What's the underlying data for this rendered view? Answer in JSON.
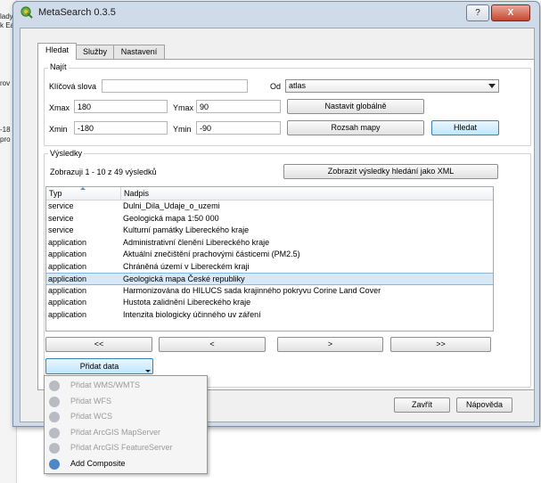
{
  "background": {
    "fragments": [
      "lady",
      "k Ea",
      "rov",
      "-18",
      "pro"
    ]
  },
  "window": {
    "title": "MetaSearch 0.3.5",
    "help_btn": "?",
    "close_btn": "X"
  },
  "tabs": [
    "Hledat",
    "Služby",
    "Nastavení"
  ],
  "find": {
    "group_title": "Najít",
    "keywords_label": "Klíčová slova",
    "keywords_value": "",
    "from_label": "Od",
    "from_value": "atlas",
    "xmax_label": "Xmax",
    "xmax_value": "180",
    "ymax_label": "Ymax",
    "ymax_value": "90",
    "xmin_label": "Xmin",
    "xmin_value": "-180",
    "ymin_label": "Ymin",
    "ymin_value": "-90",
    "set_global_btn": "Nastavit globálně",
    "map_extent_btn": "Rozsah mapy",
    "search_btn": "Hledat"
  },
  "results": {
    "group_title": "Výsledky",
    "summary": "Zobrazuji 1 - 10 z 49 výsledků",
    "xml_btn": "Zobrazit výsledky hledání jako XML",
    "columns": [
      "Typ",
      "Nadpis"
    ],
    "rows": [
      [
        "service",
        "Dulni_Dila_Udaje_o_uzemi"
      ],
      [
        "service",
        "Geologická mapa 1:50 000"
      ],
      [
        "service",
        "Kulturní památky Libereckého kraje"
      ],
      [
        "application",
        "Administrativní členění Libereckého kraje"
      ],
      [
        "application",
        "Aktuální znečištění prachovými částicemi (PM2.5)"
      ],
      [
        "application",
        "Chráněná území v Libereckém kraji"
      ],
      [
        "application",
        "Geologická mapa České republiky"
      ],
      [
        "application",
        "Harmonizována do HILUCS sada krajinného pokryvu Corine Land Cover"
      ],
      [
        "application",
        "Hustota zalidnění Libereckého kraje"
      ],
      [
        "application",
        "Intenzita biologicky účinného uv záření"
      ]
    ],
    "selected_index": 6
  },
  "pager": {
    "first": "<<",
    "prev": "<",
    "next": ">",
    "last": ">>"
  },
  "add_data_btn": "Přidat data",
  "add_menu": [
    {
      "label": "Přidat WMS/WMTS",
      "enabled": false
    },
    {
      "label": "Přidat WFS",
      "enabled": false
    },
    {
      "label": "Přidat WCS",
      "enabled": false
    },
    {
      "label": "Přidat ArcGIS MapServer",
      "enabled": false
    },
    {
      "label": "Přidat ArcGIS FeatureServer",
      "enabled": false
    },
    {
      "label": "Add Composite",
      "enabled": true
    }
  ],
  "footer": {
    "close_btn": "Zavřít",
    "help_btn": "Nápověda"
  }
}
